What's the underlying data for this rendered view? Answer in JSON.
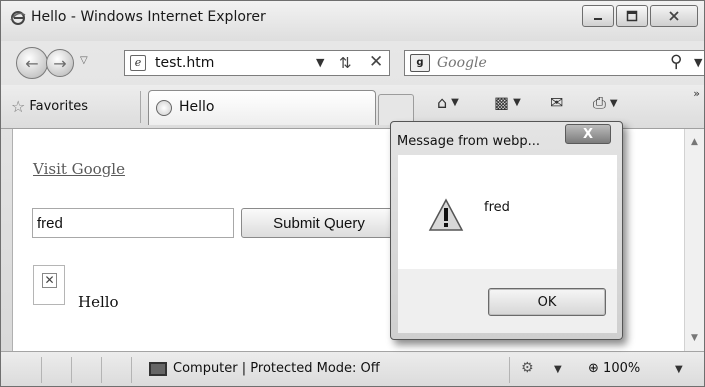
{
  "window": {
    "title": "Hello - Windows Internet Explorer",
    "minimize_icon": "minimize-icon",
    "maximize_icon": "maximize-icon",
    "close_icon": "close-icon"
  },
  "address_bar": {
    "url": "test.htm",
    "search_placeholder": "Google",
    "icons": [
      "back-icon",
      "forward-icon",
      "refresh-icon",
      "stop-icon",
      "search-icon"
    ]
  },
  "favorites_bar": {
    "favorites_label": "Favorites",
    "tab_label": "Hello",
    "command_icons": [
      "home-icon",
      "feeds-icon",
      "mail-icon",
      "print-icon"
    ]
  },
  "page": {
    "link_text": "Visit Google",
    "input_value": "fred",
    "submit_label": "Submit Query",
    "image_text": "Hello"
  },
  "dialog": {
    "title": "Message from webp...",
    "close_label": "X",
    "message": "fred",
    "ok_label": "OK"
  },
  "status_bar": {
    "zone_text": "Computer | Protected Mode: Off",
    "zoom_text": "100%"
  }
}
